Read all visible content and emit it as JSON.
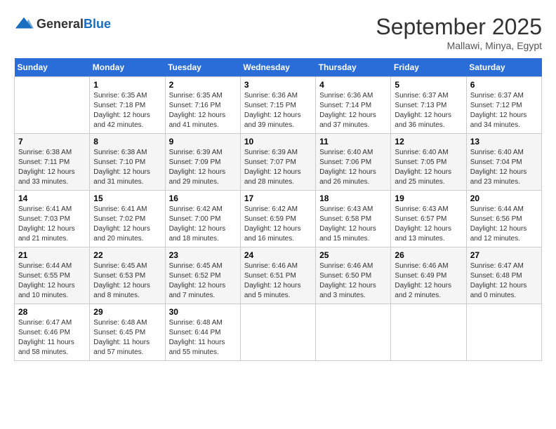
{
  "header": {
    "logo_general": "General",
    "logo_blue": "Blue",
    "month": "September 2025",
    "location": "Mallawi, Minya, Egypt"
  },
  "days_of_week": [
    "Sunday",
    "Monday",
    "Tuesday",
    "Wednesday",
    "Thursday",
    "Friday",
    "Saturday"
  ],
  "weeks": [
    [
      {
        "day": "",
        "info": ""
      },
      {
        "day": "1",
        "info": "Sunrise: 6:35 AM\nSunset: 7:18 PM\nDaylight: 12 hours\nand 42 minutes."
      },
      {
        "day": "2",
        "info": "Sunrise: 6:35 AM\nSunset: 7:16 PM\nDaylight: 12 hours\nand 41 minutes."
      },
      {
        "day": "3",
        "info": "Sunrise: 6:36 AM\nSunset: 7:15 PM\nDaylight: 12 hours\nand 39 minutes."
      },
      {
        "day": "4",
        "info": "Sunrise: 6:36 AM\nSunset: 7:14 PM\nDaylight: 12 hours\nand 37 minutes."
      },
      {
        "day": "5",
        "info": "Sunrise: 6:37 AM\nSunset: 7:13 PM\nDaylight: 12 hours\nand 36 minutes."
      },
      {
        "day": "6",
        "info": "Sunrise: 6:37 AM\nSunset: 7:12 PM\nDaylight: 12 hours\nand 34 minutes."
      }
    ],
    [
      {
        "day": "7",
        "info": "Sunrise: 6:38 AM\nSunset: 7:11 PM\nDaylight: 12 hours\nand 33 minutes."
      },
      {
        "day": "8",
        "info": "Sunrise: 6:38 AM\nSunset: 7:10 PM\nDaylight: 12 hours\nand 31 minutes."
      },
      {
        "day": "9",
        "info": "Sunrise: 6:39 AM\nSunset: 7:09 PM\nDaylight: 12 hours\nand 29 minutes."
      },
      {
        "day": "10",
        "info": "Sunrise: 6:39 AM\nSunset: 7:07 PM\nDaylight: 12 hours\nand 28 minutes."
      },
      {
        "day": "11",
        "info": "Sunrise: 6:40 AM\nSunset: 7:06 PM\nDaylight: 12 hours\nand 26 minutes."
      },
      {
        "day": "12",
        "info": "Sunrise: 6:40 AM\nSunset: 7:05 PM\nDaylight: 12 hours\nand 25 minutes."
      },
      {
        "day": "13",
        "info": "Sunrise: 6:40 AM\nSunset: 7:04 PM\nDaylight: 12 hours\nand 23 minutes."
      }
    ],
    [
      {
        "day": "14",
        "info": "Sunrise: 6:41 AM\nSunset: 7:03 PM\nDaylight: 12 hours\nand 21 minutes."
      },
      {
        "day": "15",
        "info": "Sunrise: 6:41 AM\nSunset: 7:02 PM\nDaylight: 12 hours\nand 20 minutes."
      },
      {
        "day": "16",
        "info": "Sunrise: 6:42 AM\nSunset: 7:00 PM\nDaylight: 12 hours\nand 18 minutes."
      },
      {
        "day": "17",
        "info": "Sunrise: 6:42 AM\nSunset: 6:59 PM\nDaylight: 12 hours\nand 16 minutes."
      },
      {
        "day": "18",
        "info": "Sunrise: 6:43 AM\nSunset: 6:58 PM\nDaylight: 12 hours\nand 15 minutes."
      },
      {
        "day": "19",
        "info": "Sunrise: 6:43 AM\nSunset: 6:57 PM\nDaylight: 12 hours\nand 13 minutes."
      },
      {
        "day": "20",
        "info": "Sunrise: 6:44 AM\nSunset: 6:56 PM\nDaylight: 12 hours\nand 12 minutes."
      }
    ],
    [
      {
        "day": "21",
        "info": "Sunrise: 6:44 AM\nSunset: 6:55 PM\nDaylight: 12 hours\nand 10 minutes."
      },
      {
        "day": "22",
        "info": "Sunrise: 6:45 AM\nSunset: 6:53 PM\nDaylight: 12 hours\nand 8 minutes."
      },
      {
        "day": "23",
        "info": "Sunrise: 6:45 AM\nSunset: 6:52 PM\nDaylight: 12 hours\nand 7 minutes."
      },
      {
        "day": "24",
        "info": "Sunrise: 6:46 AM\nSunset: 6:51 PM\nDaylight: 12 hours\nand 5 minutes."
      },
      {
        "day": "25",
        "info": "Sunrise: 6:46 AM\nSunset: 6:50 PM\nDaylight: 12 hours\nand 3 minutes."
      },
      {
        "day": "26",
        "info": "Sunrise: 6:46 AM\nSunset: 6:49 PM\nDaylight: 12 hours\nand 2 minutes."
      },
      {
        "day": "27",
        "info": "Sunrise: 6:47 AM\nSunset: 6:48 PM\nDaylight: 12 hours\nand 0 minutes."
      }
    ],
    [
      {
        "day": "28",
        "info": "Sunrise: 6:47 AM\nSunset: 6:46 PM\nDaylight: 11 hours\nand 58 minutes."
      },
      {
        "day": "29",
        "info": "Sunrise: 6:48 AM\nSunset: 6:45 PM\nDaylight: 11 hours\nand 57 minutes."
      },
      {
        "day": "30",
        "info": "Sunrise: 6:48 AM\nSunset: 6:44 PM\nDaylight: 11 hours\nand 55 minutes."
      },
      {
        "day": "",
        "info": ""
      },
      {
        "day": "",
        "info": ""
      },
      {
        "day": "",
        "info": ""
      },
      {
        "day": "",
        "info": ""
      }
    ]
  ]
}
